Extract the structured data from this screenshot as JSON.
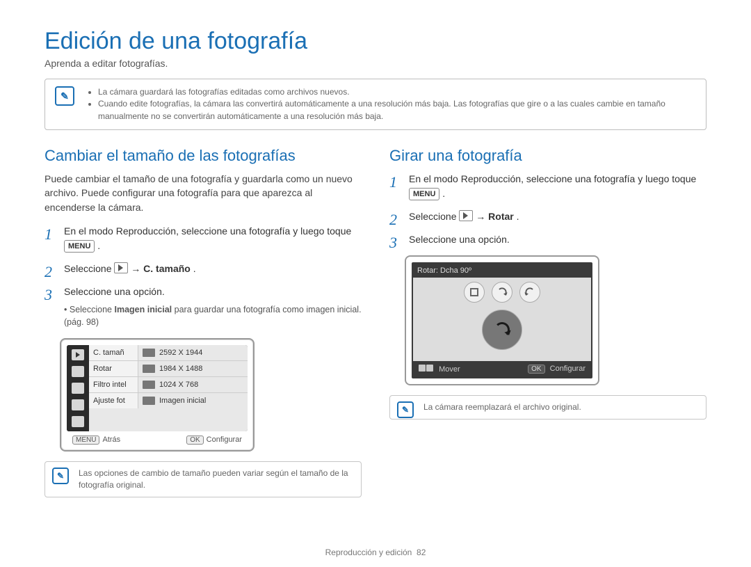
{
  "page": {
    "title": "Edición de una fotografía",
    "subtitle": "Aprenda a editar fotografías.",
    "footer_section": "Reproducción y edición",
    "footer_page": "82"
  },
  "top_info": {
    "bullet1": "La cámara guardará las fotografías editadas como archivos nuevos.",
    "bullet2": "Cuando edite fotografías, la cámara las convertirá automáticamente a una resolución más baja. Las fotografías que gire o a las cuales cambie en tamaño manualmente no se convertirán automáticamente a una resolución más baja."
  },
  "left": {
    "heading": "Cambiar el tamaño de las fotografías",
    "intro": "Puede cambiar el tamaño de una fotografía y guardarla como un nuevo archivo. Puede configurar una fotografía para que aparezca al encenderse la cámara.",
    "step1a": "En el modo Reproducción, seleccione una fotografía y luego toque ",
    "step1b": ".",
    "menu_label": "MENU",
    "step2a": "Seleccione ",
    "step2b": " → ",
    "step2_bold": "C. tamaño",
    "step2c": ".",
    "step3": "Seleccione una opción.",
    "step3_sub_a": "Seleccione ",
    "step3_sub_bold": "Imagen inicial",
    "step3_sub_b": " para guardar una fotografía como imagen inicial. (pág. 98)",
    "menu_rows": {
      "r1_label": "C. tamañ",
      "r1_val": "2592 X 1944",
      "r2_label": "Rotar",
      "r2_val": "1984 X 1488",
      "r3_label": "Filtro intel",
      "r3_val": "1024 X 768",
      "r4_label": "Ajuste fot",
      "r4_val": "Imagen inicial"
    },
    "footer_back_chip": "MENU",
    "footer_back": "Atrás",
    "footer_ok_chip": "OK",
    "footer_ok": "Configurar",
    "info_note": "Las opciones de cambio de tamaño pueden variar según el tamaño de la fotografía original."
  },
  "right": {
    "heading": "Girar una fotografía",
    "step1a": "En el modo Reproducción, seleccione una fotografía y luego toque ",
    "step1b": ".",
    "menu_label": "MENU",
    "step2a": "Seleccione ",
    "step2b": " → ",
    "step2_bold": "Rotar",
    "step2c": ".",
    "step3": "Seleccione una opción.",
    "screen_title": "Rotar: Dcha 90º",
    "screen_move": "Mover",
    "screen_ok_chip": "OK",
    "screen_ok": "Configurar",
    "info_note": "La cámara reemplazará el archivo original."
  }
}
